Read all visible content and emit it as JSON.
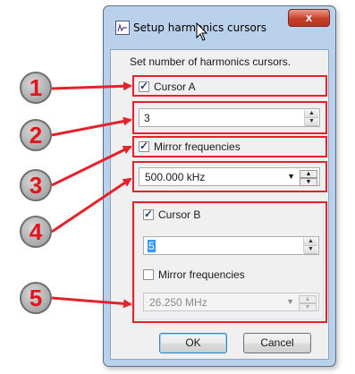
{
  "window": {
    "title": "Setup harmonics cursors",
    "close_label": "x"
  },
  "instruction": "Set number of harmonics cursors.",
  "cursor_a": {
    "label": "Cursor A",
    "checked": true,
    "count_value": "3",
    "mirror_label": "Mirror frequencies",
    "mirror_checked": true,
    "frequency_value": "500.000 kHz"
  },
  "cursor_b": {
    "label": "Cursor B",
    "checked": true,
    "count_value": "5",
    "mirror_label": "Mirror frequencies",
    "mirror_checked": false,
    "frequency_value": "26.250 MHz"
  },
  "buttons": {
    "ok": "OK",
    "cancel": "Cancel"
  },
  "annotations": [
    "1",
    "2",
    "3",
    "4",
    "5"
  ],
  "colors": {
    "annotation_red": "#e5222a",
    "window_frame": "#b9d1ea",
    "selection": "#3399ff"
  }
}
